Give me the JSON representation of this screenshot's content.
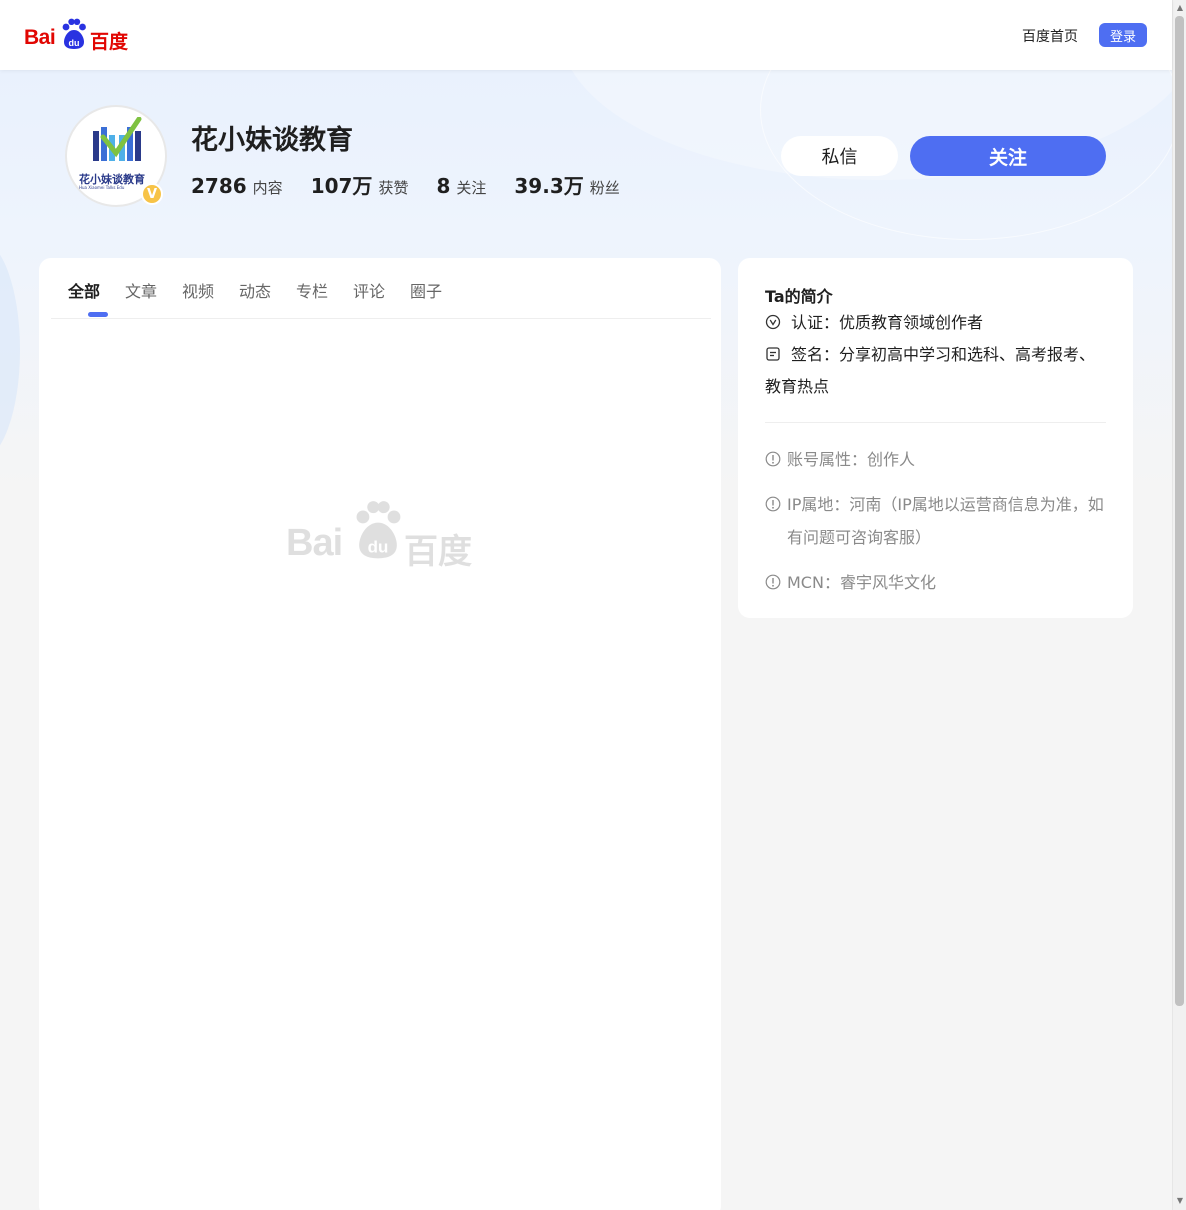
{
  "header": {
    "logo_text_left": "Bai",
    "logo_text_paw": "du",
    "logo_text_right": "百度",
    "home_link": "百度首页",
    "login_button": "登录"
  },
  "profile": {
    "name": "花小妹谈教育",
    "avatar_text": "花小妹谈教育",
    "avatar_subtext": "Hua Xiaomei Talks Edu",
    "verified_badge": "V",
    "stats": [
      {
        "value": "2786",
        "label": "内容"
      },
      {
        "value": "107万",
        "label": "获赞"
      },
      {
        "value": "8",
        "label": "关注"
      },
      {
        "value": "39.3万",
        "label": "粉丝"
      }
    ],
    "message_button": "私信",
    "follow_button": "关注"
  },
  "tabs": [
    {
      "label": "全部",
      "active": true
    },
    {
      "label": "文章",
      "active": false
    },
    {
      "label": "视频",
      "active": false
    },
    {
      "label": "动态",
      "active": false
    },
    {
      "label": "专栏",
      "active": false
    },
    {
      "label": "评论",
      "active": false
    },
    {
      "label": "圈子",
      "active": false
    }
  ],
  "placeholder": {
    "text_left": "Bai",
    "text_paw": "du",
    "text_right": "百度"
  },
  "intro": {
    "title": "Ta的简介",
    "certification": "认证：优质教育领域创作者",
    "signature_line1": "签名：分享初高中学习和选科、高考报考、",
    "signature_line2": "教育热点",
    "account_type": "账号属性：创作人",
    "ip_location": "IP属地：河南（IP属地以运营商信息为准，如有问题可咨询客服）",
    "mcn": "MCN：睿宇风华文化"
  },
  "colors": {
    "brand_blue": "#4e6ef2",
    "baidu_red": "#e10602",
    "badge_gold": "#f7c347"
  }
}
